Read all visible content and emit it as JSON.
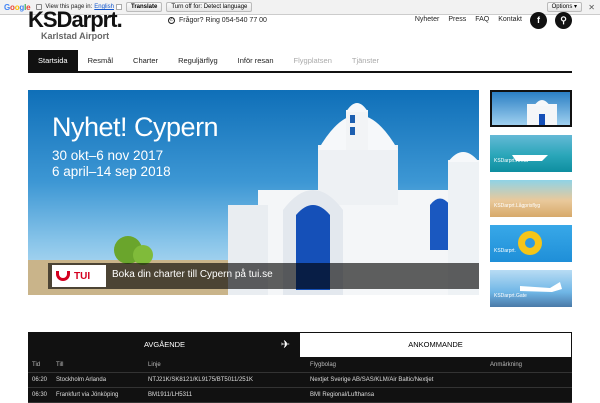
{
  "translate_bar": {
    "logo": "Google",
    "view_text": "View this page in:",
    "language": "English",
    "translate_btn": "Translate",
    "turn_off_btn": "Turn off for: Detect language",
    "options": "Options ▾",
    "close": "✕"
  },
  "header": {
    "logo": "KSDarprt.",
    "logo_sub": "Karlstad Airport",
    "phone": "Frågor? Ring 054-540 77 00",
    "links": [
      "Nyheter",
      "Press",
      "FAQ",
      "Kontakt"
    ],
    "facebook_icon": "f",
    "search_icon": "⚲"
  },
  "nav": {
    "items": [
      {
        "label": "Startsida"
      },
      {
        "label": "Resmål"
      },
      {
        "label": "Charter"
      },
      {
        "label": "Reguljärflyg"
      },
      {
        "label": "Inför resan"
      },
      {
        "label": "Flygplatsen"
      },
      {
        "label": "Tjänster"
      }
    ]
  },
  "hero": {
    "title": "Nyhet! Cypern",
    "line1": "30 okt–6 nov 2017",
    "line2": "6 april–14 sep 2018",
    "brand": "TUI",
    "cta": "Boka din charter till Cypern på tui.se"
  },
  "thumbs": [
    {
      "caption": ""
    },
    {
      "caption": "KSDarprt.Kreta"
    },
    {
      "caption": "KSDarprt.Lågprisflyg"
    },
    {
      "caption": "KSDarprt."
    },
    {
      "caption": "KSDarprt.Gate"
    }
  ],
  "flights": {
    "tab_departures": "AVGÅENDE",
    "tab_arrivals": "ANKOMMANDE",
    "plane_icon": "✈",
    "columns": [
      "Tid",
      "Till",
      "Linje",
      "Flygbolag",
      "Anmärkning"
    ],
    "rows": [
      [
        "06:20",
        "Stockholm Arlanda",
        "NTJ21K/SK8121/KL9175/BT5011/251K",
        "Nextjet Sverige AB/SAS/KLM/Air Baltic/Nextjet",
        ""
      ],
      [
        "06:30",
        "Frankfurt via Jönköping",
        "BM1911/LH5311",
        "BMI Regional/Lufthansa",
        ""
      ]
    ]
  }
}
